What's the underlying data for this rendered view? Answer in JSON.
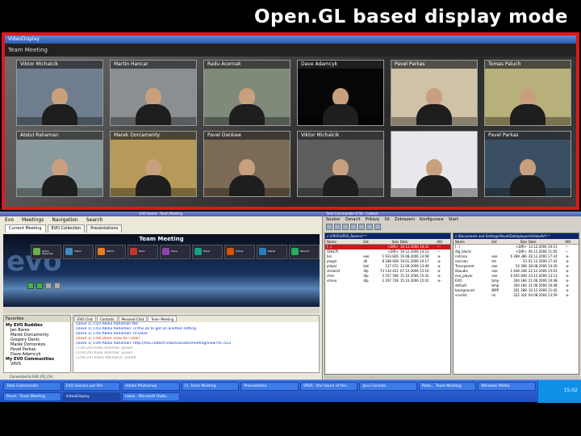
{
  "slide": {
    "title": "Open.GL based display mode"
  },
  "gl_window": {
    "title": "VideoDisplay",
    "subtitle": "Team Meeting",
    "tiles": [
      {
        "label": "Viktor Michalcik",
        "bg": "#6f7e8e"
      },
      {
        "label": "Martin Hancar",
        "bg": "#8b8f92"
      },
      {
        "label": "Radu Acernak",
        "bg": "#7f8a7a"
      },
      {
        "label": "Dave Adamcyk",
        "bg": "#060608"
      },
      {
        "label": "Pavel Parkas",
        "bg": "#cfc2a6"
      },
      {
        "label": "Tomas Paluch",
        "bg": "#b8b07a"
      },
      {
        "label": "Abdul Rahaman",
        "bg": "#8a9a9c"
      },
      {
        "label": "Marek Dorcamenty",
        "bg": "#b79a5a"
      },
      {
        "label": "Pavel Dankaw",
        "bg": "#7b6a55"
      },
      {
        "label": "Viktor Michalcik",
        "bg": "#5d5d5d"
      },
      {
        "label": "",
        "bg": "#e8e8ec"
      },
      {
        "label": "Pavel Parkas",
        "bg": "#3a4f62"
      }
    ]
  },
  "evo": {
    "title": "EVO Home - Team Meeting",
    "menu": [
      "Evo",
      "Meetings",
      "Navigation",
      "Search"
    ],
    "tabs": [
      "Current Meeting",
      "EVO Collection",
      "Presentations"
    ],
    "meeting_title": "Team Meeting",
    "logo": "evo",
    "participants": [
      {
        "name": "Abdul Rahaman",
        "color": "#6ab04c"
      },
      {
        "name": "Viktor",
        "color": "#3c8dbc"
      },
      {
        "name": "Martin",
        "color": "#e67e22"
      },
      {
        "name": "Radu",
        "color": "#c0392b"
      },
      {
        "name": "Dave",
        "color": "#8e44ad"
      },
      {
        "name": "Pavel",
        "color": "#16a085"
      },
      {
        "name": "Tomas",
        "color": "#d35400"
      },
      {
        "name": "Marek",
        "color": "#2980b9"
      },
      {
        "name": "Pavel D",
        "color": "#27ae60"
      }
    ],
    "contacts_title": "Favorites",
    "contacts": [
      {
        "text": "My EVO Buddies",
        "group": true
      },
      {
        "text": "Jan Bares",
        "group": false
      },
      {
        "text": "Marek Dorcamenty",
        "group": false
      },
      {
        "text": "Gregory Denis",
        "group": false
      },
      {
        "text": "Marek Domonkos",
        "group": false
      },
      {
        "text": "Pavel Parkas",
        "group": false
      },
      {
        "text": "Dave Adamcyk",
        "group": false
      },
      {
        "text": "My EVO Communities",
        "group": true
      },
      {
        "text": "VRVS",
        "group": false
      }
    ],
    "chat_tabs": [
      "EVO Chat",
      "Contacts",
      "Personal Chat",
      "Team Meeting"
    ],
    "chat_lines": [
      {
        "text": "[Dave 1] 1:03 Abdul Rahaman the",
        "color": "#0033cc"
      },
      {
        "text": "[Dave 1] 1:03 Abdul Rahaman: is this ok to get on another setting",
        "color": "#0033cc"
      },
      {
        "text": "[Dave 1] 1:04 Abdul Rahaman: Hi Dave",
        "color": "#0033cc"
      },
      {
        "text": "[Dave 1] 1:04 Dave: How do I look?",
        "color": "#cc3300"
      },
      {
        "text": "[Dave 1] 1:04 Abdul Rahaman: http://evo.caltech.edu/evoGate/meeting/view?id=523",
        "color": "#0033cc"
      },
      {
        "text": "[1:00:29] Radu Acernak: joined",
        "color": "#888888"
      },
      {
        "text": "[1:00:29] Radu Acernak: joined",
        "color": "#888888"
      },
      {
        "text": "[1:00:29] Viktor Michalcik: joined",
        "color": "#888888"
      }
    ],
    "status": "Connected to EVO (P2_CA)"
  },
  "tc": {
    "title": "Total Commander 6.56 - Caltech",
    "menu": [
      "Soubor",
      "Oznacit",
      "Prikazy",
      "Sit",
      "Zobrazeni",
      "Konfigurace",
      "Start"
    ],
    "left_path": "c:\\VRVS\\VRVS_Rooms\\*.*",
    "right_path": "c:\\Documents and Settings\\Pavel\\Data\\players\\VideoAV\\*.*",
    "columns": [
      "Name",
      "Ext",
      "Size",
      "Date",
      "Attr"
    ],
    "left_rows": [
      {
        "name": "[..]",
        "ext": "",
        "size": "<DIR>",
        "date": "18.12.2006 10:41",
        "attr": "---"
      },
      {
        "name": "[DHCP]",
        "ext": "",
        "size": "<DIR>",
        "date": "19.12.2006 14:12",
        "attr": "---"
      },
      {
        "name": "bin",
        "ext": "exe",
        "size": "1 933 826",
        "date": "19.08.2006 13:08",
        "attr": "-a-"
      },
      {
        "name": "plugin",
        "ext": "dll",
        "size": "8 188 928",
        "date": "19.01.2006 10:17",
        "attr": "-a-"
      },
      {
        "name": "player",
        "ext": "bat",
        "size": "137 072",
        "date": "12.09.2006 13:49",
        "attr": "-a-"
      },
      {
        "name": "stream2",
        "ext": "dlp",
        "size": "73 134 421",
        "date": "07.12.2006 15:10",
        "attr": "-a-"
      },
      {
        "name": "vlrec",
        "ext": "dlp",
        "size": "5 357 568",
        "date": "15.10.2006 15:41",
        "attr": "-a-"
      },
      {
        "name": "vlrevo",
        "ext": "dlp",
        "size": "2 297 728",
        "date": "15.10.2006 15:41",
        "attr": "-a-"
      }
    ],
    "right_rows": [
      {
        "name": "[..]",
        "ext": "",
        "size": "<DIR>",
        "date": "13.12.2006 10:11",
        "attr": "---"
      },
      {
        "name": "dlg_blocki",
        "ext": "",
        "size": "<DIR>",
        "date": "06.12.2006 11:05",
        "attr": "---"
      },
      {
        "name": "nvtrace",
        "ext": "exe",
        "size": "6 388 386",
        "date": "28.12.2006 17:24",
        "attr": "-a-"
      },
      {
        "name": "revision",
        "ext": "txt",
        "size": "53",
        "date": "01.12.2006 17:42",
        "attr": "-a-"
      },
      {
        "name": "Transparent",
        "ext": "exe",
        "size": "54 368",
        "date": "28.08.2006 14:30",
        "attr": "-a-"
      },
      {
        "name": "libaudio",
        "ext": "exe",
        "size": "1 446 248",
        "date": "22.12.2006 15:03",
        "attr": "-a-"
      },
      {
        "name": "evo_player",
        "ext": "exe",
        "size": "6 405 848",
        "date": "23.12.2006 13:13",
        "attr": "-a-"
      },
      {
        "name": "EVO",
        "ext": "bmp",
        "size": "304 184",
        "date": "21.06.2006 10:48",
        "attr": "-a-"
      },
      {
        "name": "default",
        "ext": "bmp",
        "size": "304 184",
        "date": "21.06.2006 10:48",
        "attr": "-a-"
      },
      {
        "name": "background",
        "ext": "BMP",
        "size": "261 288",
        "date": "10.12.2006 11:42",
        "attr": "-a-"
      },
      {
        "name": "vrvslist",
        "ext": "ini",
        "size": "322 324",
        "date": "04.08.2004 13:59",
        "attr": "-a-"
      }
    ]
  },
  "taskbar": {
    "tasks_row1": [
      "Total Commander",
      "EVO Session per Pre",
      "Adobe Photoshop",
      "Cr. Team Meeting",
      "Presentation",
      "VRVS - the future of the...",
      "Java Console",
      "Radu... Team Meeting",
      "Windows Media"
    ],
    "tasks_row2": [
      "Pavel - Team Meeting",
      "VideoDisplay",
      "Inbox - Microsoft Outlo..."
    ],
    "tray_time": "15:02"
  }
}
